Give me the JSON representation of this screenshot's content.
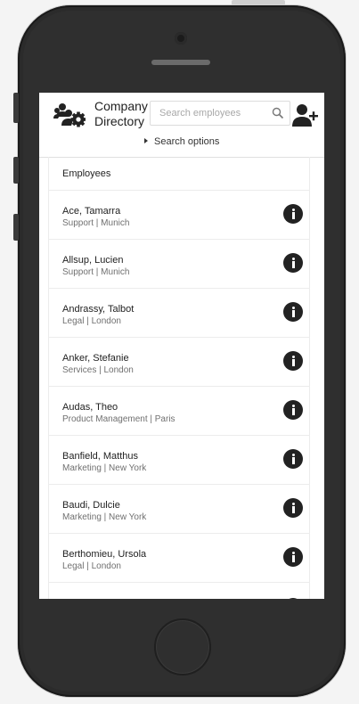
{
  "header": {
    "title_line1": "Company",
    "title_line2": "Directory",
    "search_placeholder": "Search employees",
    "search_options_label": "Search options"
  },
  "list": {
    "header": "Employees",
    "items": [
      {
        "name": "Ace, Tamarra",
        "detail": "Support | Munich"
      },
      {
        "name": "Allsup, Lucien",
        "detail": "Support | Munich"
      },
      {
        "name": "Andrassy, Talbot",
        "detail": "Legal | London"
      },
      {
        "name": "Anker, Stefanie",
        "detail": "Services | London"
      },
      {
        "name": "Audas, Theo",
        "detail": "Product Management | Paris"
      },
      {
        "name": "Banfield, Matthus",
        "detail": "Marketing | New York"
      },
      {
        "name": "Baudi, Dulcie",
        "detail": "Marketing | New York"
      },
      {
        "name": "Berthomieu, Ursola",
        "detail": "Legal | London"
      }
    ]
  },
  "icons": {
    "logo": "users-gear-icon",
    "search": "search-icon",
    "add_user": "add-user-icon",
    "info": "info-icon"
  }
}
